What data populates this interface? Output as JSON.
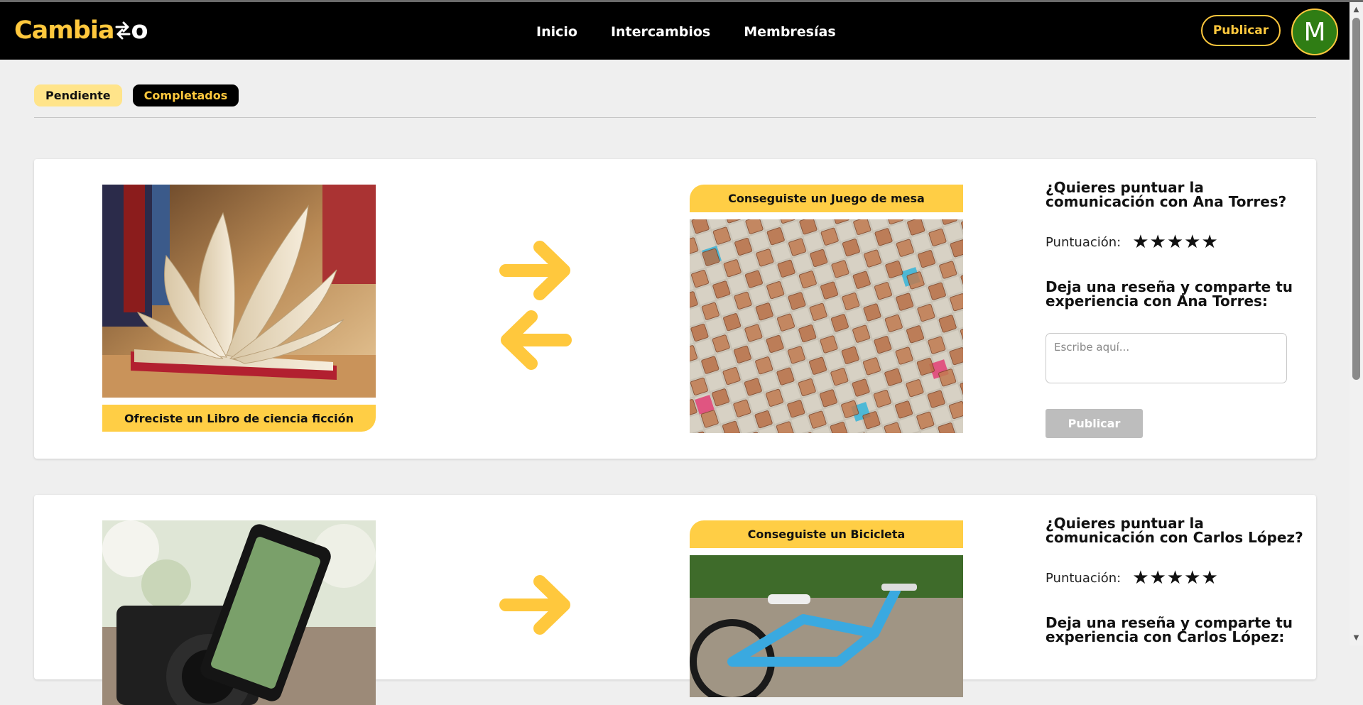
{
  "nav": {
    "logo_text": "Cambia",
    "logo_suffix": "o",
    "links": [
      "Inicio",
      "Intercambios",
      "Membresías"
    ],
    "publish_label": "Publicar",
    "avatar_initial": "M"
  },
  "filters": {
    "pending_label": "Pendiente",
    "completed_label": "Completados",
    "active": "Completados"
  },
  "exchanges": [
    {
      "offered_label": "Ofreciste un Libro de ciencia ficción",
      "offered_image": "open-book",
      "received_label": "Conseguiste un Juego de mesa",
      "received_image": "scrabble-board",
      "rate_question": "¿Quieres puntuar la comunicación con Ana Torres?",
      "score_label": "Puntuación:",
      "stars": "★★★★★",
      "review_question": "Deja una reseña y comparte tu experiencia con Ana Torres:",
      "review_placeholder": "Escribe aquí...",
      "publish_label": "Publicar"
    },
    {
      "offered_label": "",
      "offered_image": "camera-and-phone",
      "received_label": "Conseguiste un Bicicleta",
      "received_image": "blue-bicycle",
      "rate_question": "¿Quieres puntuar la comunicación con Carlos López?",
      "score_label": "Puntuación:",
      "stars": "★★★★★",
      "review_question": "Deja una reseña y comparte tu experiencia con Carlos López:"
    }
  ],
  "colors": {
    "accent": "#ffc83d",
    "label_bg": "#ffce45",
    "navbar_bg": "#000000",
    "page_bg": "#efefef",
    "avatar_bg": "#2f7d14",
    "disabled_button": "#bdbdbd"
  }
}
